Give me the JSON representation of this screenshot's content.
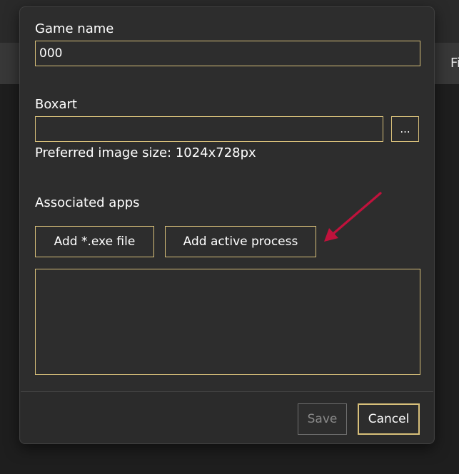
{
  "background": {
    "right_label": "Fi"
  },
  "dialog": {
    "game_name_label": "Game name",
    "game_name_value": "000",
    "boxart_label": "Boxart",
    "boxart_value": "",
    "browse_label": "...",
    "preferred_size_text": "Preferred image size: 1024x728px",
    "associated_apps_label": "Associated apps",
    "add_exe_label": "Add *.exe file",
    "add_process_label": "Add active process",
    "apps_list": [],
    "save_label": "Save",
    "cancel_label": "Cancel"
  },
  "colors": {
    "accent_border": "#d8c07a",
    "annotation_arrow": "#c0123c",
    "dialog_bg": "#2d2d2d"
  }
}
